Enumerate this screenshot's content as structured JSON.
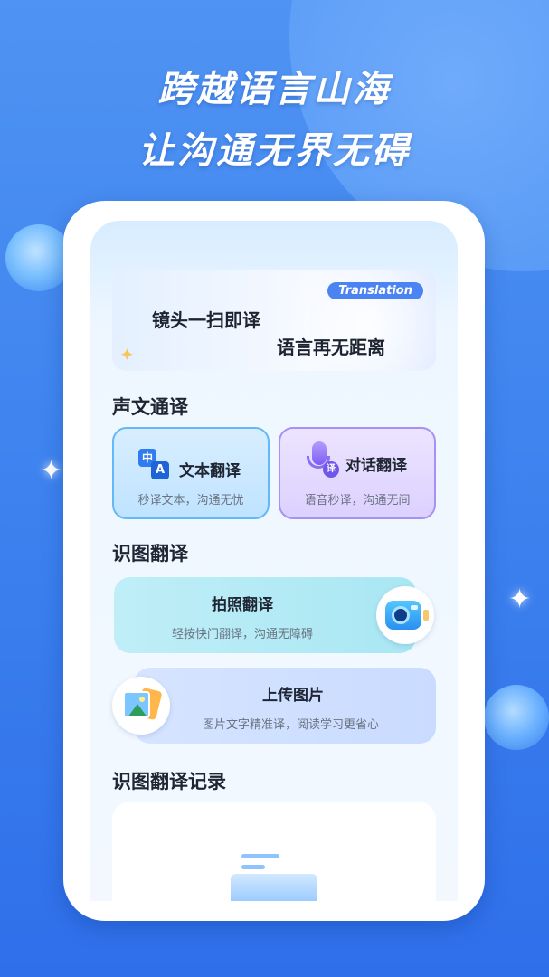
{
  "headline": {
    "line1": "跨越语言山海",
    "line2": "让沟通无界无碍"
  },
  "banner": {
    "tag": "Translation",
    "line1": "镜头一扫即译",
    "line2": "语言再无距离"
  },
  "sections": {
    "voice_text": {
      "title": "声文通译",
      "text_translate": {
        "icon_glyph_a": "中",
        "icon_glyph_b": "A",
        "title": "文本翻译",
        "subtitle": "秒译文本，沟通无忧"
      },
      "dialog_translate": {
        "icon_badge": "译",
        "title": "对话翻译",
        "subtitle": "语音秒译，沟通无间"
      }
    },
    "image_translate": {
      "title": "识图翻译",
      "photo": {
        "title": "拍照翻译",
        "subtitle": "轻按快门翻译，沟通无障碍"
      },
      "upload": {
        "title": "上传图片",
        "subtitle": "图片文字精准译，阅读学习更省心"
      }
    },
    "history": {
      "title": "识图翻译记录"
    }
  },
  "colors": {
    "background": "#3f84ef",
    "accent_blue": "#4b83f3",
    "text_card_border": "#63b9f5",
    "dialog_card_border": "#a891f5"
  },
  "icons": {
    "sparkles": "sparkle-icon",
    "text_translate": "translate-icon",
    "dialog_translate": "microphone-icon",
    "photo": "camera-icon",
    "upload": "picture-icon",
    "empty": "empty-tray-icon"
  }
}
